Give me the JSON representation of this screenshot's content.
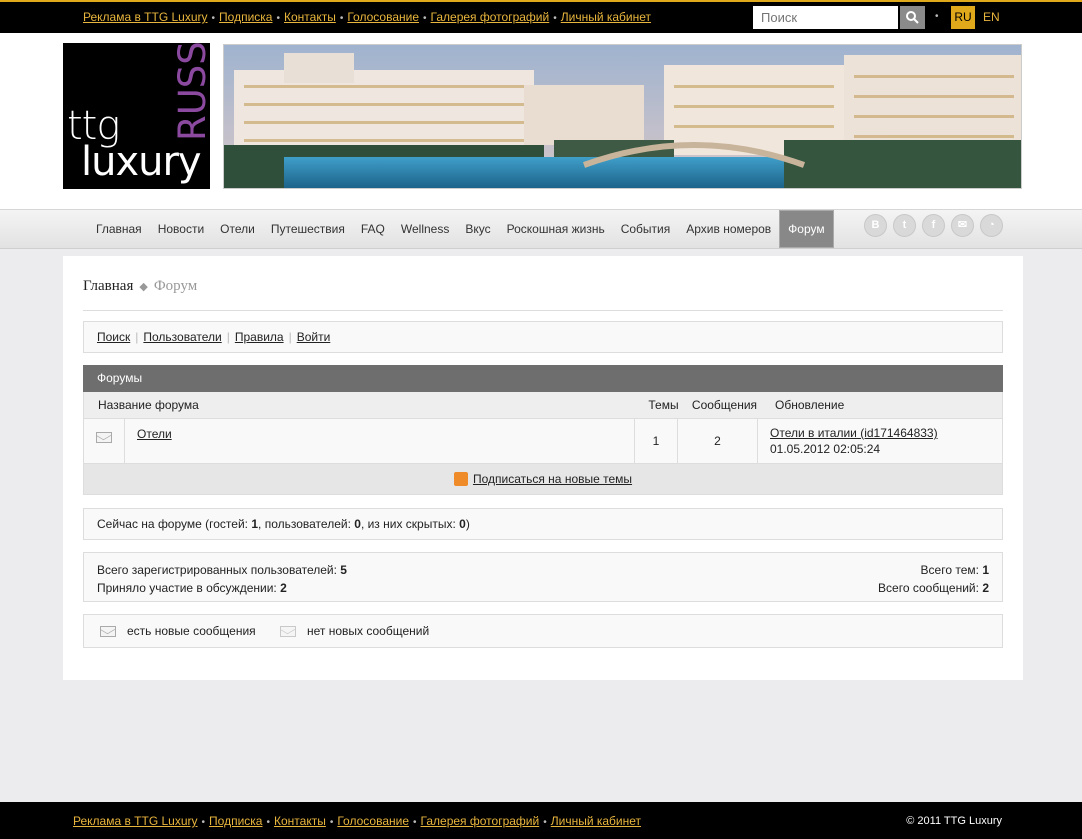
{
  "top": {
    "links": [
      "Реклама в TTG Luxury",
      "Подписка",
      "Контакты",
      "Голосование",
      "Галерея фотографий",
      "Личный кабинет"
    ],
    "search_placeholder": "Поиск",
    "lang_ru": "RU",
    "lang_en": "EN"
  },
  "logo": {
    "line1": "ttg",
    "line2": "luxury",
    "vertical": "RUSSIA"
  },
  "nav": {
    "items": [
      "Главная",
      "Новости",
      "Отели",
      "Путешествия",
      "FAQ",
      "Wellness",
      "Вкус",
      "Роскошная жизнь",
      "События",
      "Архив номеров",
      "Форум"
    ],
    "active": "Форум",
    "social_icons": [
      "vk-icon",
      "twitter-icon",
      "facebook-icon",
      "mail-icon",
      "rss-icon"
    ]
  },
  "breadcrumb": {
    "home": "Главная",
    "current": "Форум"
  },
  "forum_menu": [
    "Поиск",
    "Пользователи",
    "Правила",
    "Войти"
  ],
  "forums": {
    "title": "Форумы",
    "columns": {
      "name": "Название форума",
      "topics": "Темы",
      "messages": "Сообщения",
      "updated": "Обновление"
    },
    "rows": [
      {
        "name": "Отели",
        "topics": "1",
        "messages": "2",
        "last_topic": "Отели в италии (id171464833)",
        "last_date": "01.05.2012 02:05:24"
      }
    ],
    "subscribe": "Подписаться на новые темы"
  },
  "online": {
    "prefix": "Сейчас на форуме (гостей: ",
    "guests": "1",
    "mid1": ", пользователей: ",
    "users": "0",
    "mid2": ", из них скрытых: ",
    "hidden": "0",
    "suffix": ")"
  },
  "stats": {
    "registered_label": "Всего зарегистрированных пользователей: ",
    "registered": "5",
    "participated_label": "Приняло участие в обсуждении: ",
    "participated": "2",
    "topics_label": "Всего тем: ",
    "topics": "1",
    "messages_label": "Всего сообщений: ",
    "messages": "2"
  },
  "legend": {
    "new": "есть новые сообщения",
    "none": "нет новых сообщений"
  },
  "footer": {
    "links": [
      "Реклама в TTG Luxury",
      "Подписка",
      "Контакты",
      "Голосование",
      "Галерея фотографий",
      "Личный кабинет"
    ],
    "copyright": "© 2011 TTG Luxury"
  }
}
